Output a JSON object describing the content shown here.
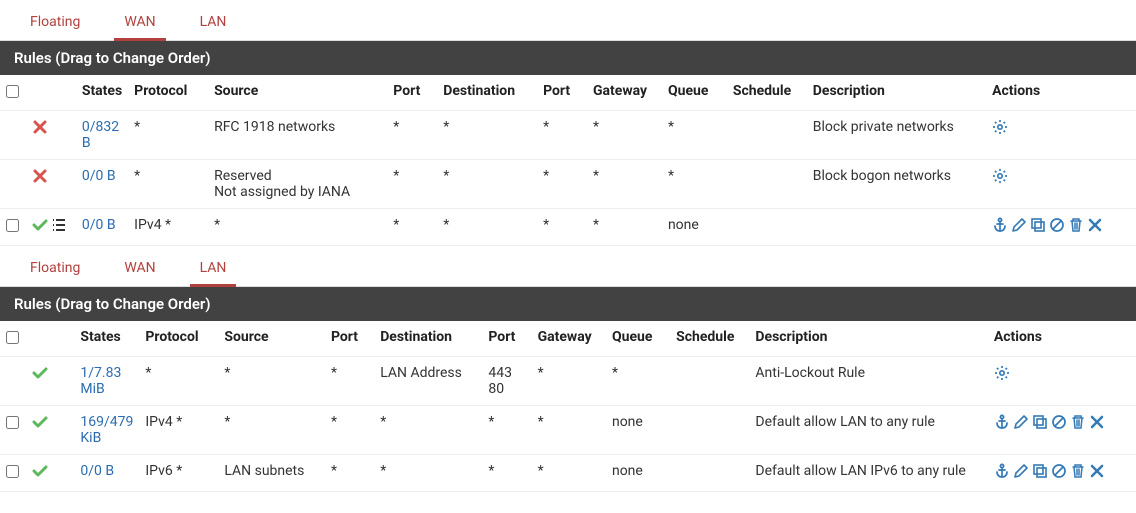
{
  "wan": {
    "tabs": [
      "Floating",
      "WAN",
      "LAN"
    ],
    "active_tab": 1,
    "section_title": "Rules (Drag to Change Order)",
    "columns": [
      "",
      "",
      "States",
      "Protocol",
      "Source",
      "Port",
      "Destination",
      "Port",
      "Gateway",
      "Queue",
      "Schedule",
      "Description",
      "Actions"
    ],
    "rows": [
      {
        "checkbox": null,
        "status": "reject",
        "states": "0/832 B",
        "protocol": "*",
        "source": "RFC 1918 networks",
        "sport": "*",
        "dest": "*",
        "dport": "*",
        "gateway": "*",
        "queue": "*",
        "schedule": "",
        "description": "Block private networks",
        "actions": "gear"
      },
      {
        "checkbox": null,
        "status": "reject",
        "states": "0/0 B",
        "protocol": "*",
        "source": "Reserved\nNot assigned by IANA",
        "sport": "*",
        "dest": "*",
        "dport": "*",
        "gateway": "*",
        "queue": "*",
        "schedule": "",
        "description": "Block bogon networks",
        "actions": "gear"
      },
      {
        "checkbox": true,
        "status": "pass-list",
        "states": "0/0 B",
        "protocol": "IPv4 *",
        "source": "*",
        "sport": "*",
        "dest": "*",
        "dport": "*",
        "gateway": "*",
        "queue": "none",
        "schedule": "",
        "description": "",
        "actions": "full"
      }
    ]
  },
  "lan": {
    "tabs": [
      "Floating",
      "WAN",
      "LAN"
    ],
    "active_tab": 2,
    "section_title": "Rules (Drag to Change Order)",
    "columns": [
      "",
      "",
      "States",
      "Protocol",
      "Source",
      "Port",
      "Destination",
      "Port",
      "Gateway",
      "Queue",
      "Schedule",
      "Description",
      "Actions"
    ],
    "rows": [
      {
        "checkbox": null,
        "status": "pass",
        "states": "1/7.83 MiB",
        "protocol": "*",
        "source": "*",
        "sport": "*",
        "dest": "LAN Address",
        "dport": "443\n80",
        "gateway": "*",
        "queue": "*",
        "schedule": "",
        "description": "Anti-Lockout Rule",
        "actions": "gear"
      },
      {
        "checkbox": true,
        "status": "pass",
        "states": "169/479 KiB",
        "protocol": "IPv4 *",
        "source": "*",
        "sport": "*",
        "dest": "*",
        "dport": "*",
        "gateway": "*",
        "queue": "none",
        "schedule": "",
        "description": "Default allow LAN to any rule",
        "actions": "full"
      },
      {
        "checkbox": true,
        "status": "pass",
        "states": "0/0 B",
        "protocol": "IPv6 *",
        "source": "LAN subnets",
        "sport": "*",
        "dest": "*",
        "dport": "*",
        "gateway": "*",
        "queue": "none",
        "schedule": "",
        "description": "Default allow LAN IPv6 to any rule",
        "actions": "full"
      }
    ]
  }
}
